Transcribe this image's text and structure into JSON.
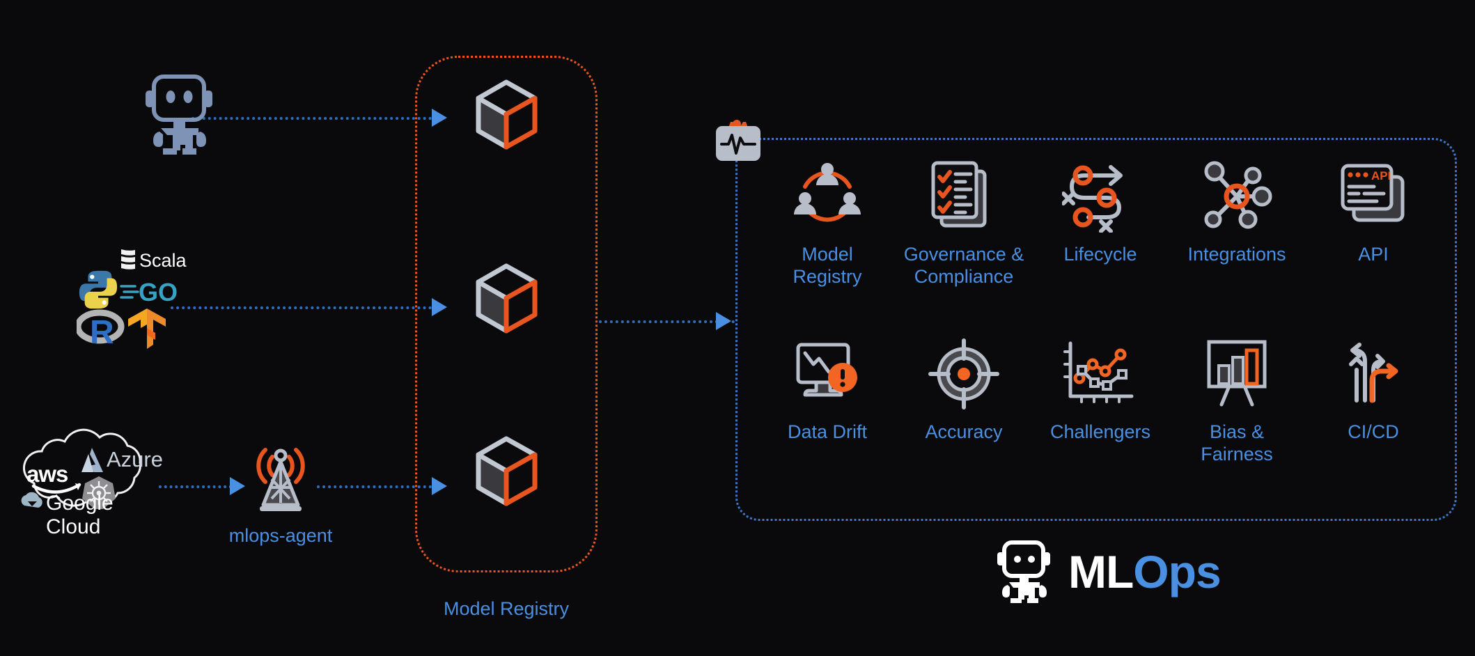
{
  "background": "#0a0a0c",
  "colors": {
    "orange": "#e8551f",
    "blue": "#4a90e2",
    "gray": "#b7bec9",
    "dark_gray": "#3a3a3e",
    "white": "#ffffff"
  },
  "sources": {
    "agent_robot": {
      "icon": "robot-icon"
    },
    "languages": {
      "items": [
        {
          "name": "Scala",
          "label": "Scala"
        },
        {
          "name": "Python",
          "label": ""
        },
        {
          "name": "Go",
          "label": "GO"
        },
        {
          "name": "R",
          "label": "R"
        },
        {
          "name": "TensorFlow",
          "label": ""
        }
      ]
    },
    "cloud": {
      "items": [
        {
          "name": "aws",
          "label": "aws"
        },
        {
          "name": "azure",
          "label": "Azure"
        },
        {
          "name": "kubernetes",
          "label": ""
        },
        {
          "name": "google-cloud",
          "label": "Google Cloud"
        }
      ]
    },
    "mlops_agent": {
      "label": "mlops-agent",
      "icon": "broadcast-tower-icon"
    }
  },
  "registry": {
    "label": "Model Registry",
    "cubes": 3,
    "border_color": "#e8551f"
  },
  "monitoring_badge": {
    "icon": "pulse-monitor-icon",
    "gear": "gear-icon"
  },
  "mlops": {
    "border_color": "#3b78c9",
    "items": [
      {
        "key": "model-registry",
        "label": "Model\nRegistry",
        "icon": "users-network-icon"
      },
      {
        "key": "governance-compliance",
        "label": "Governance &\nCompliance",
        "icon": "checklist-documents-icon"
      },
      {
        "key": "lifecycle",
        "label": "Lifecycle",
        "icon": "serpentine-path-icon"
      },
      {
        "key": "integrations",
        "label": "Integrations",
        "icon": "hub-network-icon"
      },
      {
        "key": "api",
        "label": "API",
        "icon": "api-window-icon",
        "badge_text": "API"
      },
      {
        "key": "data-drift",
        "label": "Data Drift",
        "icon": "monitor-alert-icon"
      },
      {
        "key": "accuracy",
        "label": "Accuracy",
        "icon": "target-crosshair-icon"
      },
      {
        "key": "challengers",
        "label": "Challengers",
        "icon": "line-chart-icon"
      },
      {
        "key": "bias-fairness",
        "label": "Bias &\nFairness",
        "icon": "bar-chart-easel-icon"
      },
      {
        "key": "ci-cd",
        "label": "CI/CD",
        "icon": "branching-arrows-icon"
      }
    ]
  },
  "brand": {
    "part1": "ML",
    "part2": "Ops",
    "icon": "robot-icon"
  }
}
